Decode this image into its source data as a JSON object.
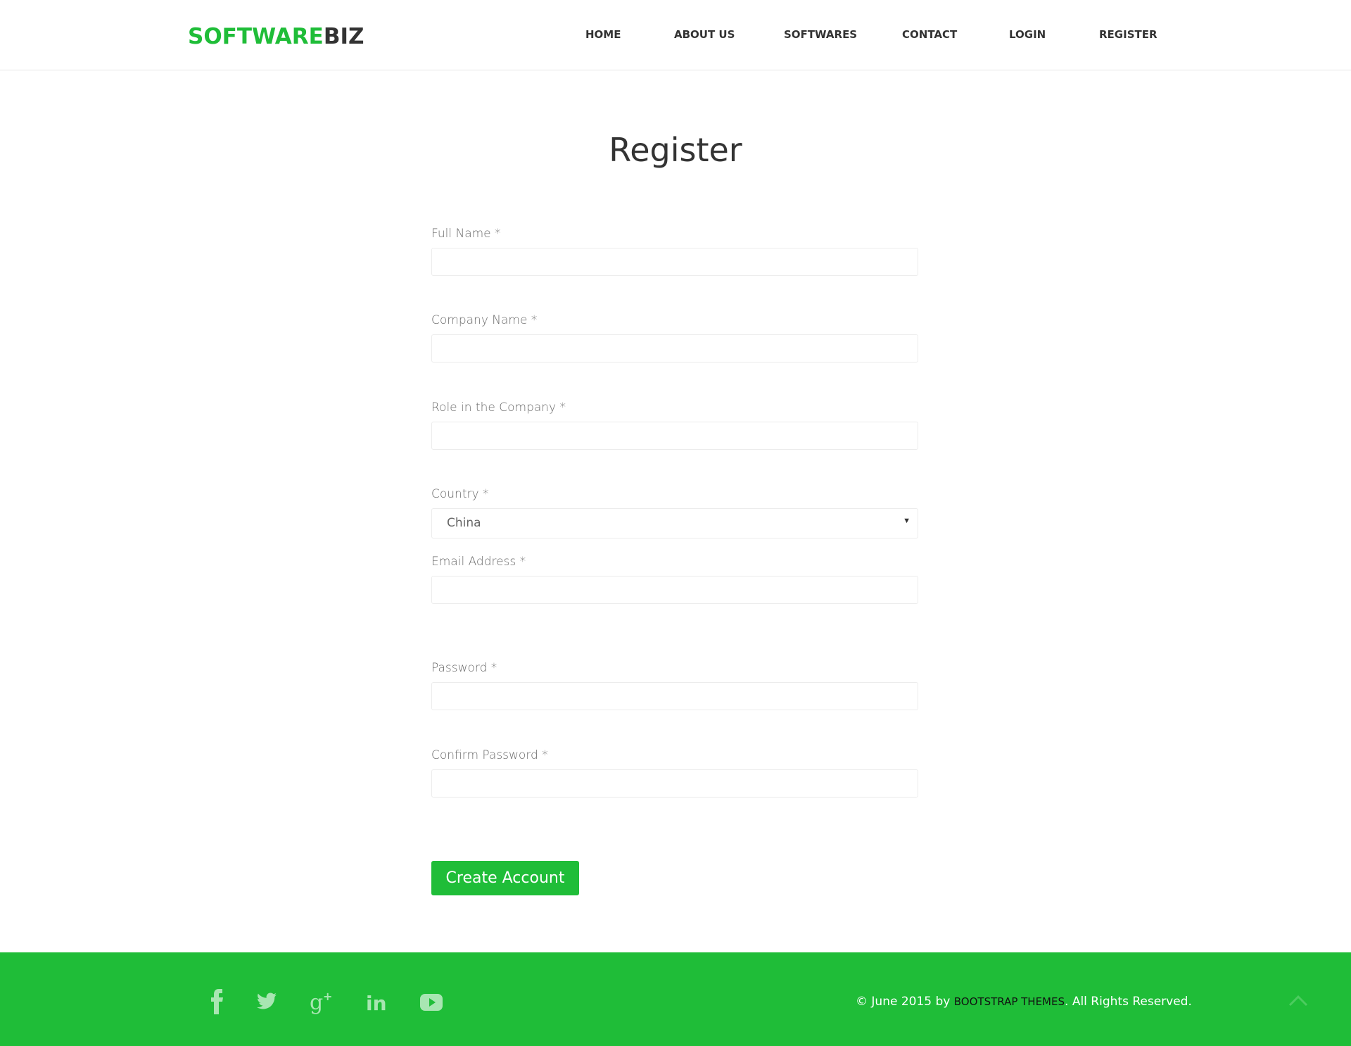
{
  "brand": {
    "part1": "SOFTWARE",
    "part2": "BIZ",
    "accent_color": "#1fbd38"
  },
  "nav": {
    "items": [
      {
        "label": "HOME"
      },
      {
        "label": "ABOUT US"
      },
      {
        "label": "SOFTWARES"
      },
      {
        "label": "CONTACT"
      },
      {
        "label": "LOGIN"
      },
      {
        "label": "REGISTER"
      }
    ]
  },
  "page": {
    "title": "Register"
  },
  "form": {
    "full_name": {
      "label": "Full Name *",
      "value": ""
    },
    "company_name": {
      "label": "Company Name *",
      "value": ""
    },
    "role": {
      "label": "Role in the Company *",
      "value": ""
    },
    "country": {
      "label": "Country *",
      "selected": "China"
    },
    "email": {
      "label": "Email Address *",
      "value": ""
    },
    "password": {
      "label": "Password *",
      "value": ""
    },
    "confirm_password": {
      "label": "Confirm Password *",
      "value": ""
    },
    "submit_label": "Create Account"
  },
  "footer": {
    "social": [
      "facebook-icon",
      "twitter-icon",
      "google-plus-icon",
      "linkedin-icon",
      "youtube-icon"
    ],
    "copyright_prefix": "© June 2015 by ",
    "copyright_link": "BOOTSTRAP THEMES",
    "copyright_suffix": ". All Rights Reserved.",
    "background": "#1fbd38"
  }
}
